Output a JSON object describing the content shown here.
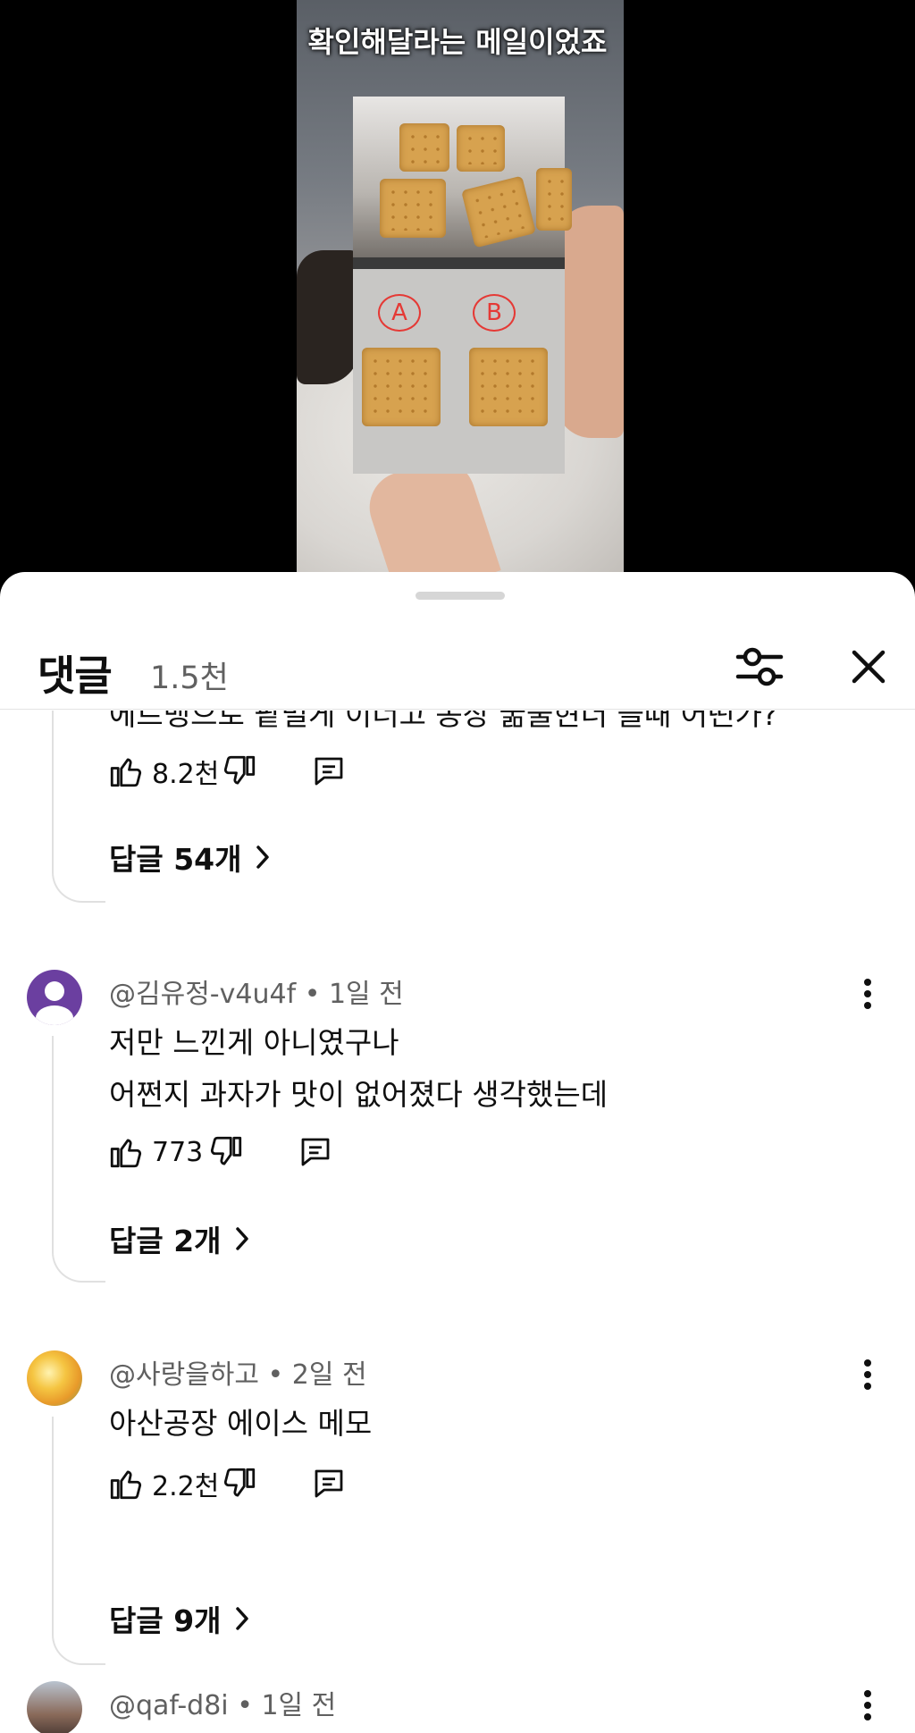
{
  "video": {
    "caption": "확인해달라는 메일이었죠",
    "photo_marks": [
      "A",
      "B"
    ]
  },
  "comments_panel": {
    "title": "댓글",
    "count": "1.5천"
  },
  "thread": {
    "partial_comment": {
      "text_fragment": "에르뱅으로 팥벌게 이너고 동장 굶줄현더 들때 어떤가?",
      "likes": "8.2천",
      "replies_label": "답글 54개"
    },
    "comments": [
      {
        "author": "@김유정-v4u4f",
        "separator": "•",
        "time": "1일 전",
        "lines": [
          "저만 느낀게 아니였구나",
          "어쩐지 과자가 맛이 없어졌다 생각했는데"
        ],
        "likes": "773",
        "replies_label": "답글 2개",
        "avatar_color": "#6b3fa0"
      },
      {
        "author": "@사랑을하고",
        "separator": "•",
        "time": "2일 전",
        "lines": [
          "아산공장 에이스 메모"
        ],
        "likes": "2.2천",
        "replies_label": "답글 9개",
        "avatar_color": "#e8c34a"
      },
      {
        "author": "@qaf-d8i",
        "separator": "•",
        "time": "1일 전",
        "lines": [],
        "likes": "",
        "replies_label": "",
        "avatar_color": "#8a5a4a"
      }
    ]
  },
  "icons": [
    "filter-icon",
    "close-icon",
    "thumbs-up-icon",
    "thumbs-down-icon",
    "reply-icon",
    "more-vert-icon",
    "chevron-right-icon"
  ]
}
